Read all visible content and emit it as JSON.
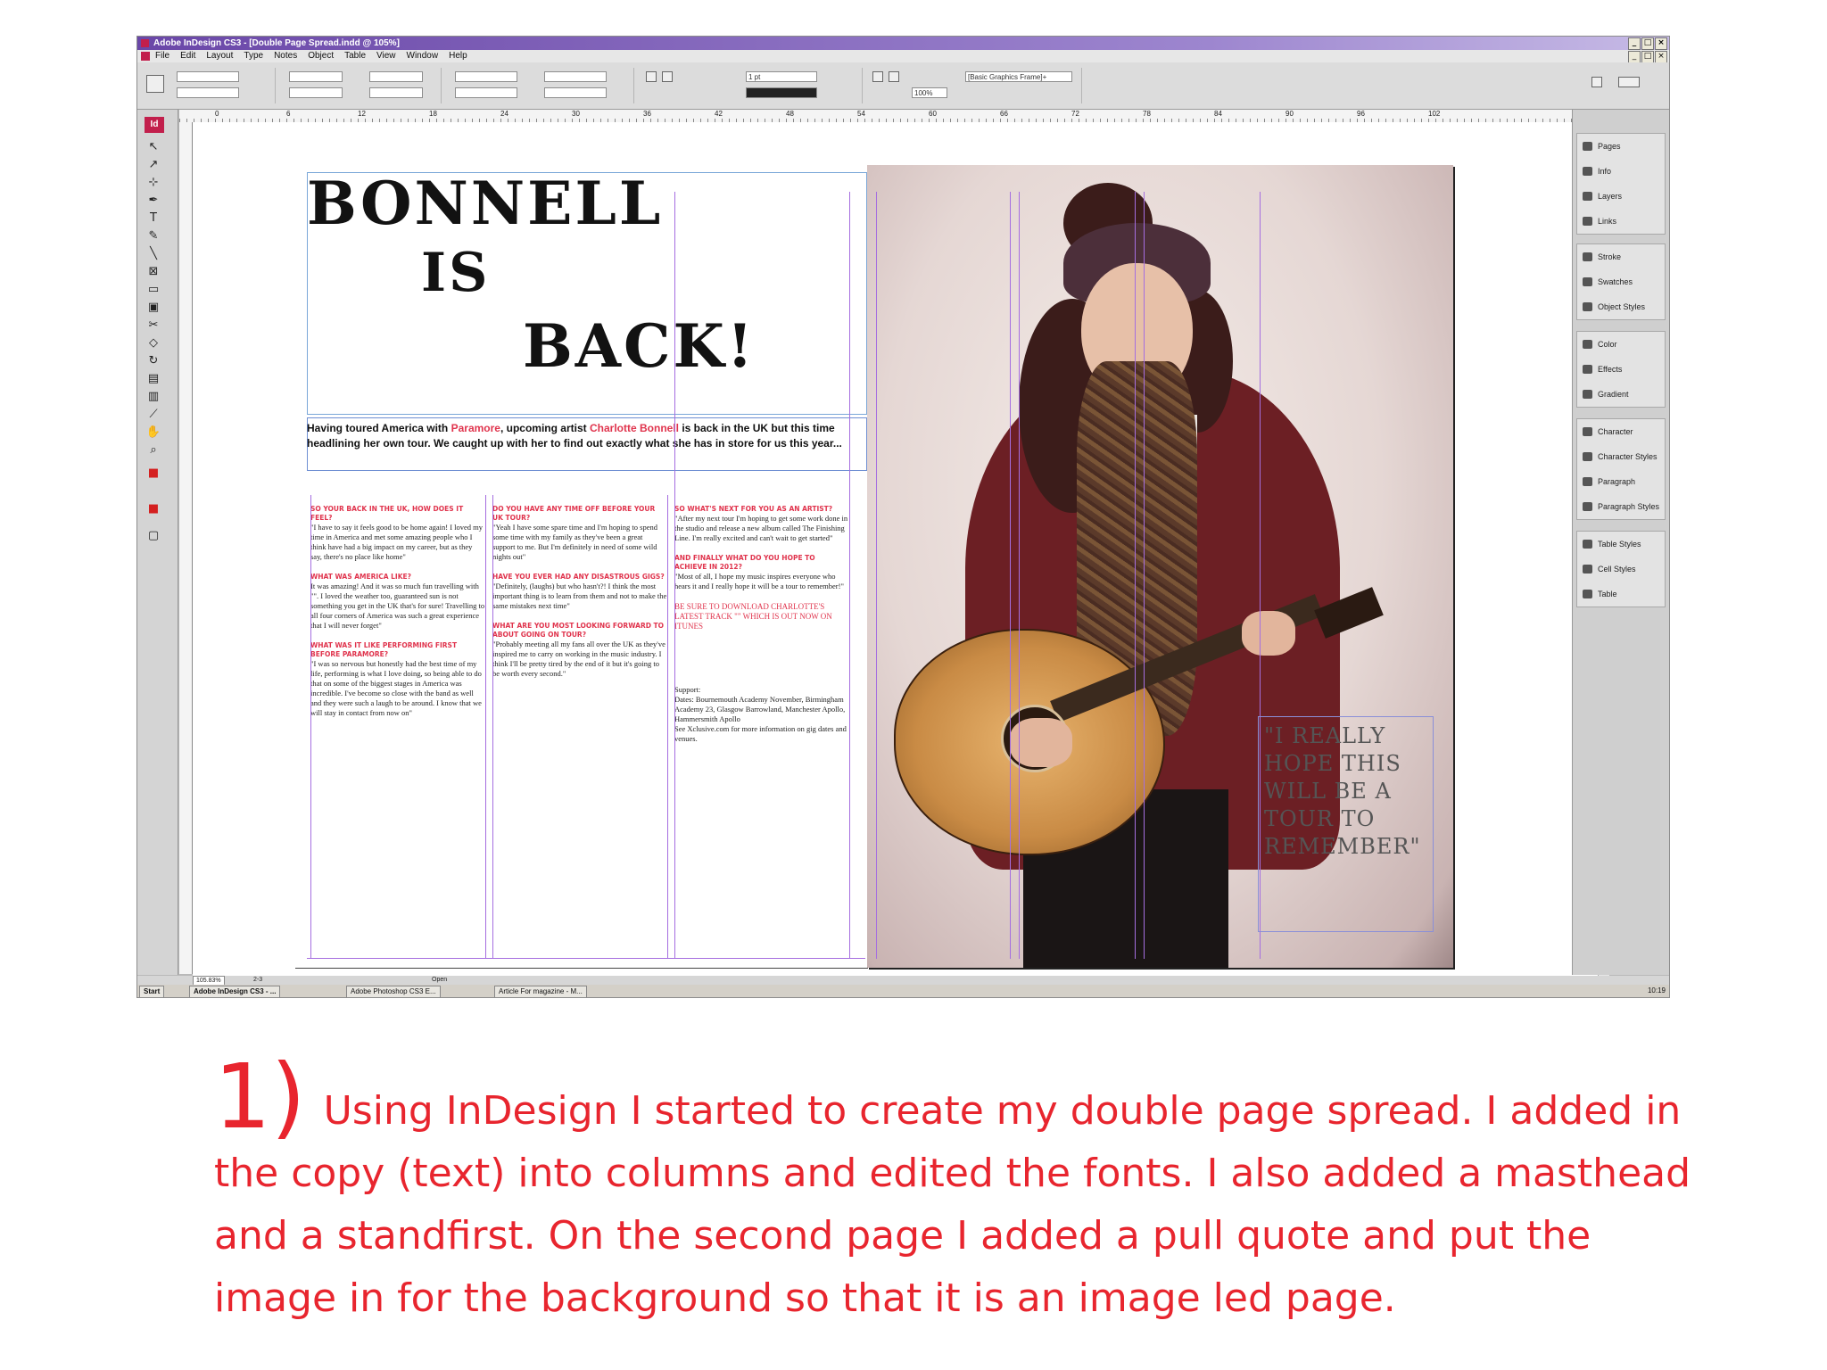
{
  "window": {
    "title": "Adobe InDesign CS3 - [Double Page Spread.indd @ 105%]",
    "menu": [
      "File",
      "Edit",
      "Layout",
      "Type",
      "Notes",
      "Object",
      "Table",
      "View",
      "Window",
      "Help"
    ],
    "frame_style": "[Basic Graphics Frame]+",
    "zoom_field": "100%",
    "stroke_weight": "1 pt"
  },
  "ruler": [
    "0",
    "6",
    "12",
    "18",
    "24",
    "30",
    "36",
    "42",
    "48",
    "54",
    "60",
    "66",
    "72",
    "78",
    "84",
    "90",
    "96",
    "102"
  ],
  "spread": {
    "masthead": [
      "BONNELL",
      "IS",
      "BACK!"
    ],
    "standfirst": {
      "part1": "Having toured America with ",
      "red1": "Paramore",
      "part2": ", upcoming artist ",
      "red2": "Charlotte Bonnell",
      "part3": " is back in the UK but this time headlining her own tour. We caught up with her to find out exactly what she has in store for us this year..."
    },
    "columns": [
      [
        {
          "q": "SO YOUR BACK IN THE UK, HOW DOES IT FEEL?",
          "a": "\"I have to say it feels good to be home again! I loved my time in America and met some amazing people who I think have had a big impact on my career, but as they say, there's no place like home\""
        },
        {
          "q": "WHAT WAS AMERICA LIKE?",
          "a": "It was amazing! And it was so much fun travelling with \"\". I loved the weather too, guaranteed sun is not something you get in the UK that's for sure! Travelling to all four corners of America was such a great experience that I will never forget\""
        },
        {
          "q": "WHAT WAS IT LIKE PERFORMING FIRST BEFORE PARAMORE?",
          "a": "\"I was so nervous but honestly had the best time of my life, performing is what I love doing, so being able to do that on some of the biggest stages in America was incredible. I've become so close with the band as well and they were such a laugh to be around. I know that we will stay in contact from now on\""
        }
      ],
      [
        {
          "q": "DO YOU HAVE ANY TIME OFF BEFORE YOUR UK TOUR?",
          "a": "\"Yeah I have some spare time and I'm hoping to spend some time with my family as they've been a great support to me. But I'm definitely in need of some wild nights out\""
        },
        {
          "q": "HAVE YOU EVER HAD ANY DISASTROUS GIGS?",
          "a": "\"Definitely, (laughs) but who hasn't?! I think the most important thing is to learn from them and not to make the same mistakes next time\""
        },
        {
          "q": "WHAT ARE YOU MOST LOOKING FORWARD TO ABOUT GOING ON TOUR?",
          "a": "\"Probably meeting all my fans all over the UK as they've inspired me to carry on working in the music industry. I think I'll be pretty tired by the end of it but it's going to be worth every second.\""
        }
      ],
      [
        {
          "q": "SO WHAT'S NEXT FOR YOU AS AN ARTIST?",
          "a": "\"After my next tour I'm hoping to get some work done in the studio and release a new album called The Finishing Line. I'm really excited and can't wait to get started\""
        },
        {
          "q": "AND FINALLY WHAT DO YOU HOPE TO ACHIEVE IN 2012?",
          "a": "\"Most of all, I hope my music inspires everyone who hears it and I really hope it will be a tour to remember!\""
        }
      ]
    ],
    "promo": "BE SURE TO DOWNLOAD CHARLOTTE'S LATEST TRACK \"\" WHICH IS OUT NOW ON ITUNES",
    "support": "Support:\nDates: Bournemouth Academy November, Birmingham Academy 23, Glasgow Barrowland, Manchester Apollo, Hammersmith Apollo\nSee Xclusive.com for more information on gig dates and venues.",
    "pull_quote": "\"I REALLY HOPE THIS WILL BE A TOUR TO REMEMBER\""
  },
  "panels": [
    [
      "Pages",
      "Info",
      "Layers",
      "Links"
    ],
    [
      "Stroke",
      "Swatches",
      "Object Styles"
    ],
    [
      "Color",
      "Effects",
      "Gradient"
    ],
    [
      "Character",
      "Character Styles",
      "Paragraph",
      "Paragraph Styles"
    ],
    [
      "Table Styles",
      "Cell Styles",
      "Table"
    ]
  ],
  "status": {
    "zoom": "105.83%",
    "page": "2-3",
    "open": "Open"
  },
  "taskbar": {
    "start": "Start",
    "tasks": [
      "Adobe InDesign CS3 - ...",
      "Adobe Photoshop CS3 E...",
      "Article For magazine - M..."
    ],
    "clock": "10:19"
  },
  "caption": {
    "number": "1)",
    "text": "Using InDesign I started to create my double page spread.  I added in the copy (text) into columns and edited the fonts. I also added a masthead and a standfirst. On the second page I added a pull quote and put the image in for the background so that it is an image led page."
  },
  "colors": {
    "accent_red": "#e8252e",
    "indesign_brand": "#c21f4c",
    "guide": "#a56ee0"
  }
}
